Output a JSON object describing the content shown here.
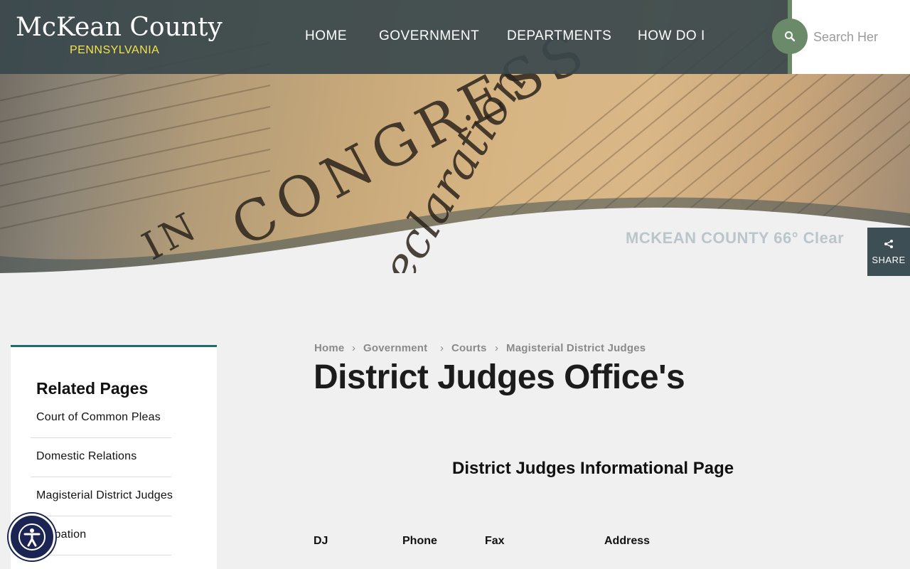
{
  "header": {
    "logo_title": "McKean County",
    "logo_subtitle": "PENNSYLVANIA",
    "nav": [
      "HOME",
      "GOVERNMENT",
      "DEPARTMENTS",
      "HOW DO I"
    ],
    "search_placeholder": "Search Her",
    "search_icon": "search-icon"
  },
  "hero": {
    "weather_text": "MCKEAN COUNTY   66° Clear",
    "share_label": "SHARE",
    "share_icon": "share-icon"
  },
  "breadcrumb": [
    "Home",
    "Government",
    "Courts",
    "Magisterial District Judges"
  ],
  "page_title": "District Judges Office's",
  "section_title": "District Judges Informational Page",
  "table_headers": [
    "DJ",
    "Phone",
    "Fax",
    "Address"
  ],
  "sidebar": {
    "title": "Related Pages",
    "items": [
      "Court of Common Pleas",
      "Domestic Relations",
      "Magisterial District Judges",
      "Probation"
    ]
  },
  "accessibility_icon": "accessibility-icon",
  "colors": {
    "header_bg": "#3a484c",
    "accent_green": "#6b8a6a",
    "logo_yellow": "#f2e34b",
    "sidebar_border": "#1e6b70",
    "access_bg": "#1b2452"
  }
}
